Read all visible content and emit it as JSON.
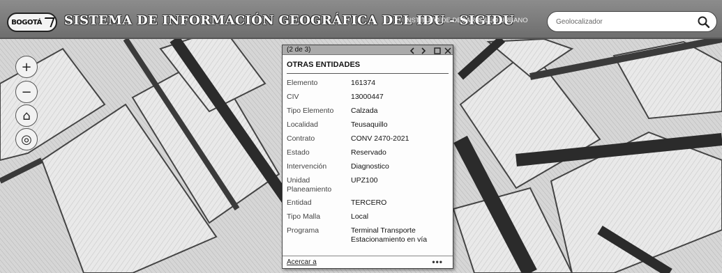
{
  "header": {
    "logo_text": "BOGOTÁ",
    "title": "SISTEMA DE INFORMACIÓN GEOGRÁFICA DEL IDU - SIGIDU",
    "subtitle": "INSTITUTO DE DESARROLLO URBANO",
    "search_placeholder": "Geolocalizador"
  },
  "map_controls": {
    "zoom_in": "+",
    "zoom_out": "−",
    "home": "⌂",
    "locate": "◎"
  },
  "popup": {
    "counter": "(2 de 3)",
    "title": "OTRAS ENTIDADES",
    "attributes": [
      {
        "key": "Elemento",
        "value": "161374"
      },
      {
        "key": "CIV",
        "value": "13000447"
      },
      {
        "key": "Tipo Elemento",
        "value": "Calzada"
      },
      {
        "key": "Localidad",
        "value": "Teusaquillo"
      },
      {
        "key": "Contrato",
        "value": "CONV 2470-2021"
      },
      {
        "key": "Estado",
        "value": "Reservado"
      },
      {
        "key": "Intervención",
        "value": "Diagnostico"
      },
      {
        "key": "Unidad Planeamiento",
        "value": "UPZ100"
      },
      {
        "key": "Entidad",
        "value": "TERCERO"
      },
      {
        "key": "Tipo Malla",
        "value": "Local"
      },
      {
        "key": "Programa",
        "value": "Terminal Transporte Estacionamiento en vía"
      }
    ],
    "zoom_link": "Acercar a",
    "more": "•••"
  },
  "colors": {
    "header_bg": "#7a7a7a",
    "road_dark": "#2b2b2b",
    "block_fill": "#e6e6e6"
  }
}
